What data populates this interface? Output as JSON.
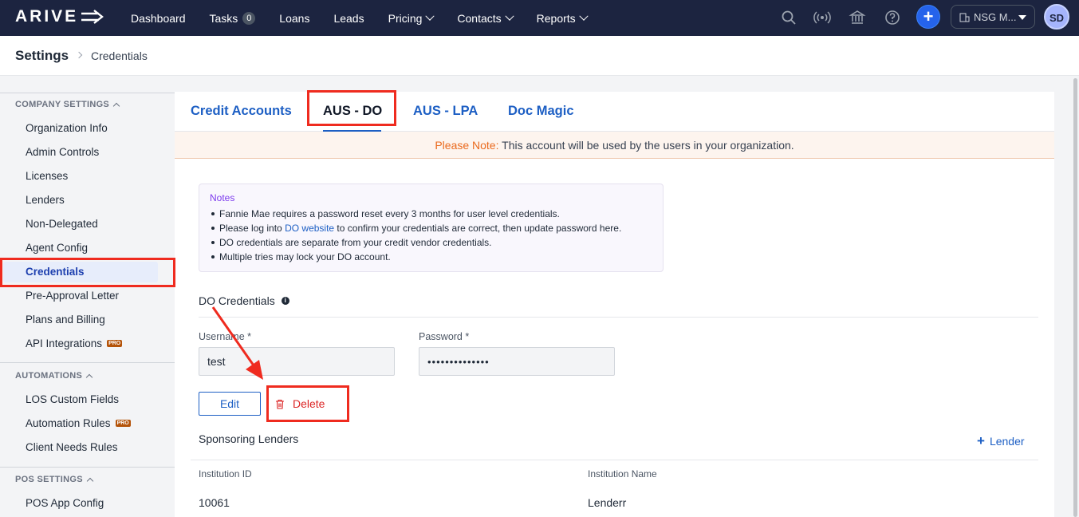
{
  "nav": {
    "logo": "ARIVE",
    "items": [
      {
        "label": "Dashboard",
        "dropdown": false
      },
      {
        "label": "Tasks",
        "badge": "0",
        "dropdown": false
      },
      {
        "label": "Loans",
        "dropdown": false
      },
      {
        "label": "Leads",
        "dropdown": false
      },
      {
        "label": "Pricing",
        "dropdown": true
      },
      {
        "label": "Contacts",
        "dropdown": true
      },
      {
        "label": "Reports",
        "dropdown": true
      }
    ],
    "org_label": "NSG M...",
    "avatar_initials": "SD",
    "icons": [
      "search-icon",
      "broadcast-icon",
      "bank-icon",
      "help-icon",
      "plus-icon"
    ]
  },
  "header": {
    "title": "Settings",
    "crumb": "Credentials"
  },
  "sidebar": {
    "company_settings": {
      "label": "COMPANY SETTINGS",
      "items": [
        "Organization Info",
        "Admin Controls",
        "Licenses",
        "Lenders",
        "Non-Delegated",
        "Agent Config",
        "Credentials",
        "Pre-Approval Letter",
        "Plans and Billing",
        "API Integrations"
      ]
    },
    "automations": {
      "label": "AUTOMATIONS",
      "items": [
        "LOS Custom Fields",
        "Automation Rules",
        "Client Needs Rules"
      ]
    },
    "pos_settings": {
      "label": "POS SETTINGS",
      "items": [
        "POS App Config"
      ]
    },
    "pro_badge": "PRO",
    "active_item": "Credentials"
  },
  "tabs": [
    "Credit Accounts",
    "AUS - DO",
    "AUS - LPA",
    "Doc Magic"
  ],
  "active_tab": "AUS - DO",
  "notice": {
    "prefix": "Please Note:",
    "text": " This account will be used by the users in your organization."
  },
  "notes": {
    "title": "Notes",
    "line1": "Fannie Mae requires a password reset every 3 months for user level credentials.",
    "line2_pre": "Please log into ",
    "line2_link": "DO website",
    "line2_post": " to confirm your credentials are correct, then update password here.",
    "line3": "DO credentials are separate from your credit vendor credentials.",
    "line4": "Multiple tries may lock your DO account."
  },
  "credentials": {
    "title": "DO Credentials",
    "username_label": "Username *",
    "username_value": "test",
    "password_label": "Password *",
    "password_value": "••••••••••••••",
    "edit_label": "Edit",
    "delete_label": "Delete"
  },
  "sponsoring": {
    "title": "Sponsoring Lenders",
    "add_label": "Lender",
    "columns": [
      "Institution ID",
      "Institution Name"
    ],
    "rows": [
      [
        "10061",
        "Lenderr"
      ]
    ]
  },
  "colors": {
    "nav_bg": "#1c2440",
    "accent": "#1d5fc4",
    "annotation": "#ef2b1f",
    "danger": "#dc2626",
    "notice": "#ea6a1e"
  }
}
